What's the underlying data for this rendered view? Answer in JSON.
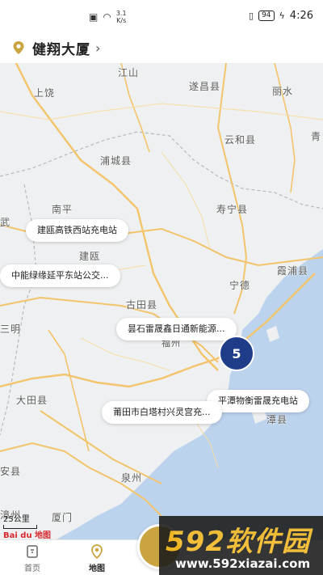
{
  "status_bar": {
    "net_speed_value": "3.1",
    "net_speed_unit": "K/s",
    "battery": "94",
    "time": "4:26"
  },
  "header": {
    "location_name": "健翔大厦"
  },
  "map": {
    "cities": [
      "江山",
      "上饶",
      "遂昌县",
      "丽水",
      "云和县",
      "青",
      "浦城县",
      "南平",
      "寿宁县",
      "建瓯",
      "武",
      "宁德",
      "霞浦县",
      "古田县",
      "三明",
      "福州",
      "大田县",
      "潭县",
      "泉州",
      "安县",
      "漳州",
      "厦门"
    ],
    "stations": [
      "建瓯高铁西站充电站",
      "中能绿缘延平东站公交...",
      "昙石雷晟鑫日通新能源...",
      "平潭物衡雷晟充电站",
      "莆田市白塔村兴灵宫充..."
    ],
    "cluster_count": "5",
    "scale_label": "25公里",
    "logo": "Bai du 地图"
  },
  "tabs": [
    {
      "label": "首页"
    },
    {
      "label": "地图"
    }
  ],
  "watermark": {
    "title": "592软件园",
    "url": "www.592xiazai.com"
  },
  "colors": {
    "accent": "#c9a440",
    "cluster": "#1f3c88",
    "sea": "#bcd3ee",
    "road": "#f3c46b"
  }
}
